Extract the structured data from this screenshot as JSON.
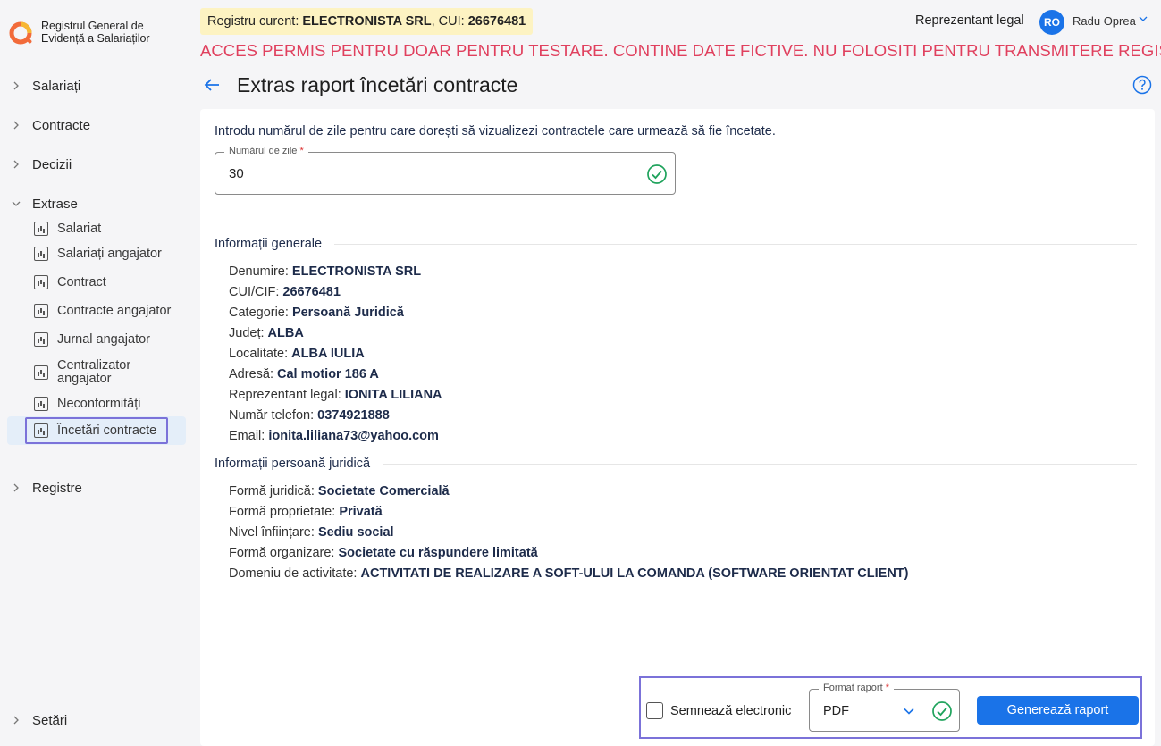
{
  "app": {
    "title_line1": "Registrul General de",
    "title_line2": "Evidență a Salariaților"
  },
  "sidebar": {
    "items": [
      {
        "label": "Salariați"
      },
      {
        "label": "Contracte"
      },
      {
        "label": "Decizii"
      },
      {
        "label": "Extrase"
      },
      {
        "label": "Registre"
      }
    ],
    "extrase_sub": [
      {
        "label": "Salariat"
      },
      {
        "label": "Salariați angajator"
      },
      {
        "label": "Contract"
      },
      {
        "label": "Contracte angajator"
      },
      {
        "label": "Jurnal angajator"
      },
      {
        "label": "Centralizator angajator"
      },
      {
        "label": "Neconformități"
      },
      {
        "label": "Încetări contracte"
      }
    ],
    "settings_label": "Setări"
  },
  "header": {
    "registry_prefix": "Registru curent: ",
    "registry_company": "ELECTRONISTA SRL",
    "registry_cui_prefix": ", CUI: ",
    "registry_cui": "26676481",
    "role": "Reprezentant legal",
    "avatar_initials": "RO",
    "user_name": "Radu Oprea",
    "warning": "ACCES PERMIS PENTRU DOAR PENTRU TESTARE. CONTINE DATE FICTIVE. NU FOLOSITI PENTRU TRANSMITERE REGISTRU"
  },
  "page": {
    "title": "Extras raport încetări contracte",
    "intro": "Introdu numărul de zile pentru care dorești să vizualizezi contractele care urmează să fie încetate.",
    "days_field": {
      "label": "Numărul de zile",
      "required_mark": "*",
      "value": "30"
    }
  },
  "general_info": {
    "title": "Informații generale",
    "rows": [
      {
        "label": "Denumire: ",
        "value": "ELECTRONISTA SRL"
      },
      {
        "label": "CUI/CIF: ",
        "value": "26676481"
      },
      {
        "label": "Categorie: ",
        "value": "Persoană Juridică"
      },
      {
        "label": "Județ: ",
        "value": "ALBA"
      },
      {
        "label": "Localitate: ",
        "value": "ALBA IULIA"
      },
      {
        "label": "Adresă: ",
        "value": "Cal motior 186 A"
      },
      {
        "label": "Reprezentant legal: ",
        "value": "IONITA LILIANA"
      },
      {
        "label": "Număr telefon: ",
        "value": "0374921888"
      },
      {
        "label": "Email: ",
        "value": "ionita.liliana73@yahoo.com"
      }
    ]
  },
  "legal_info": {
    "title": "Informații persoană juridică",
    "rows": [
      {
        "label": "Formă juridică: ",
        "value": "Societate Comercială"
      },
      {
        "label": "Formă proprietate: ",
        "value": "Privată"
      },
      {
        "label": "Nivel înființare: ",
        "value": "Sediu social"
      },
      {
        "label": "Formă organizare: ",
        "value": "Societate cu răspundere limitată"
      },
      {
        "label": "Domeniu de activitate: ",
        "value": "ACTIVITATI DE REALIZARE A SOFT-ULUI LA COMANDA (SOFTWARE ORIENTAT CLIENT)"
      }
    ]
  },
  "actions": {
    "sign_label": "Semnează electronic",
    "format_label": "Format raport",
    "format_required": "*",
    "format_value": "PDF",
    "generate_label": "Generează raport"
  },
  "colors": {
    "accent": "#1a73e8",
    "warning": "#e0405e",
    "success": "#1fa35c",
    "highlight_border": "#7b72d9",
    "badge_bg": "#fdf3c2"
  }
}
